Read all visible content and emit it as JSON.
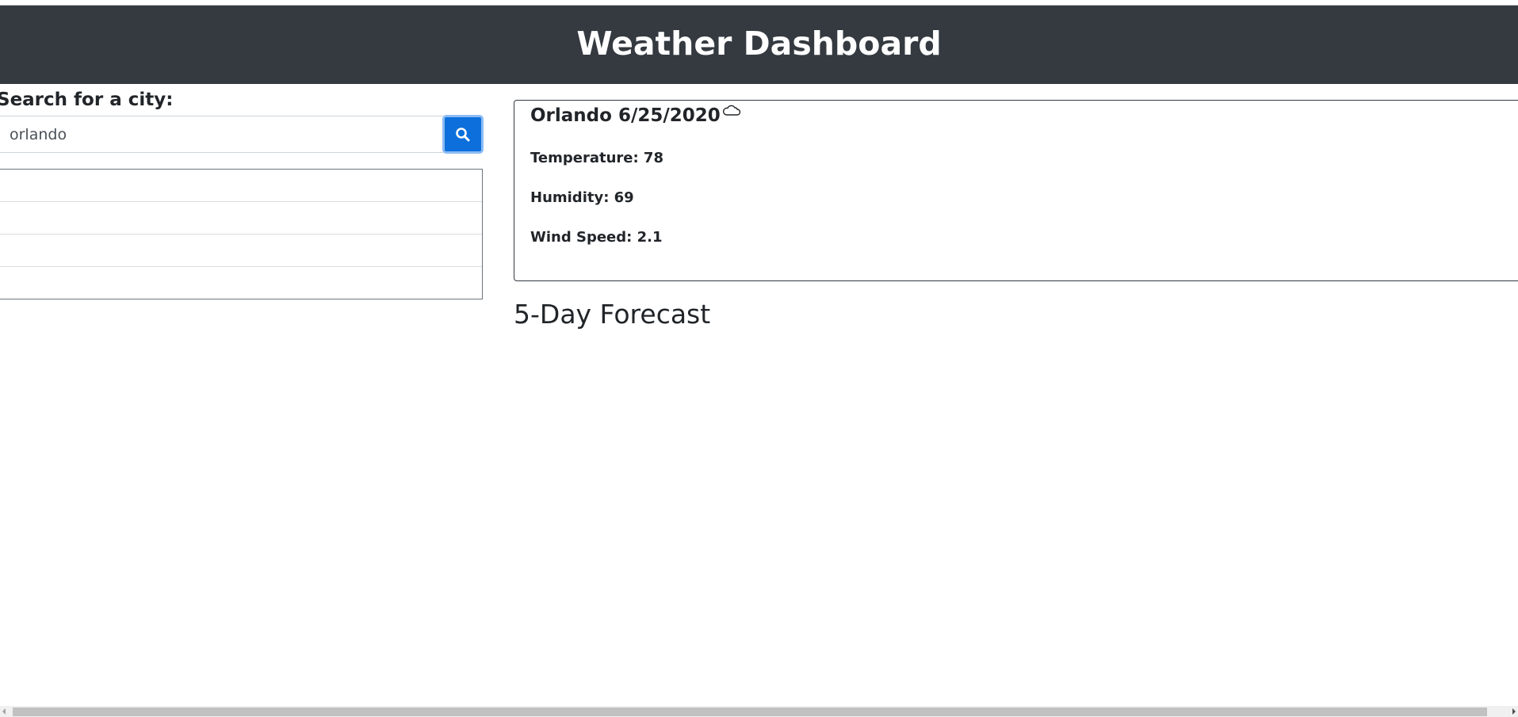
{
  "header": {
    "title": "Weather Dashboard"
  },
  "search": {
    "label": "Search for a city:",
    "value": "orlando",
    "placeholder": "",
    "button_icon": "search-icon"
  },
  "history": {
    "items": [
      "",
      "",
      "",
      ""
    ]
  },
  "current": {
    "title": "Orlando 6/25/2020",
    "icon": "cloud-icon",
    "temperature": "Temperature: 78",
    "humidity": "Humidity: 69",
    "wind": "Wind Speed: 2.1"
  },
  "forecast": {
    "title": "5-Day Forecast"
  },
  "colors": {
    "header_bg": "#343a40",
    "button_bg": "#0d6fdb",
    "button_focus_ring": "#8cbcf3"
  }
}
